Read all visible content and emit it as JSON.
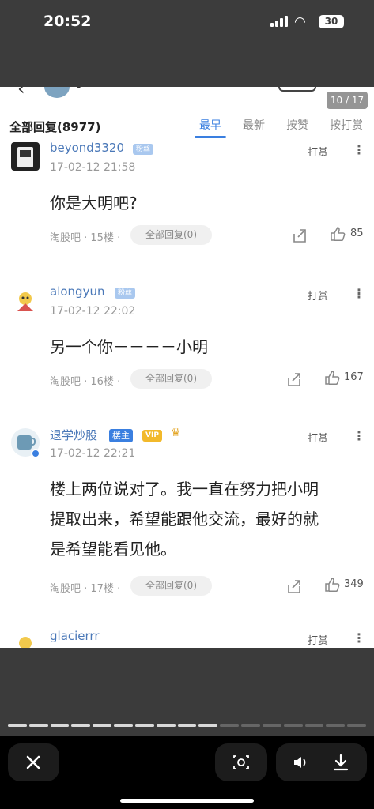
{
  "status": {
    "time": "20:52",
    "battery": "30"
  },
  "topbar": {
    "page_counter": "10 / 17"
  },
  "replies": {
    "title": "全部回复(8977)",
    "sort_tabs": [
      "最早",
      "最新",
      "按赞",
      "按打赏"
    ],
    "active_sort": "最早"
  },
  "posts": [
    {
      "username": "beyond3320",
      "badge": "粉丝",
      "date": "17-02-12 21:58",
      "reward": "打赏",
      "content": "你是大明吧?",
      "meta": "淘股吧 · 15楼 ·",
      "all_replies": "全部回复(0)",
      "likes": "85"
    },
    {
      "username": "alongyun",
      "badge": "粉丝",
      "date": "17-02-12 22:02",
      "reward": "打赏",
      "content": "另一个你－－－－小明",
      "meta": "淘股吧 · 16楼 ·",
      "all_replies": "全部回复(0)",
      "likes": "167"
    },
    {
      "username": "退学炒股",
      "badge": "楼主",
      "vip": "VIP",
      "date": "17-02-12 22:21",
      "reward": "打赏",
      "content_lines": [
        "楼上两位说对了。我一直在努力把小明",
        "提取出来，希望能跟他交流，最好的就",
        "是希望能看见他。"
      ],
      "meta": "淘股吧 · 17楼 ·",
      "all_replies": "全部回复(0)",
      "likes": "349"
    },
    {
      "username": "glacierrr",
      "reward": "打赏"
    }
  ],
  "colors": {
    "accent": "#3a7fe0",
    "username": "#4a78b8",
    "badge_owner": "#3a7fe0",
    "vip": "#f2b92b"
  },
  "icons": [
    "back-arrow-icon",
    "signal-icon",
    "wifi-icon",
    "battery-icon",
    "share-icon",
    "like-icon",
    "more-icon",
    "close-icon",
    "scan-icon",
    "volume-icon",
    "download-icon"
  ]
}
